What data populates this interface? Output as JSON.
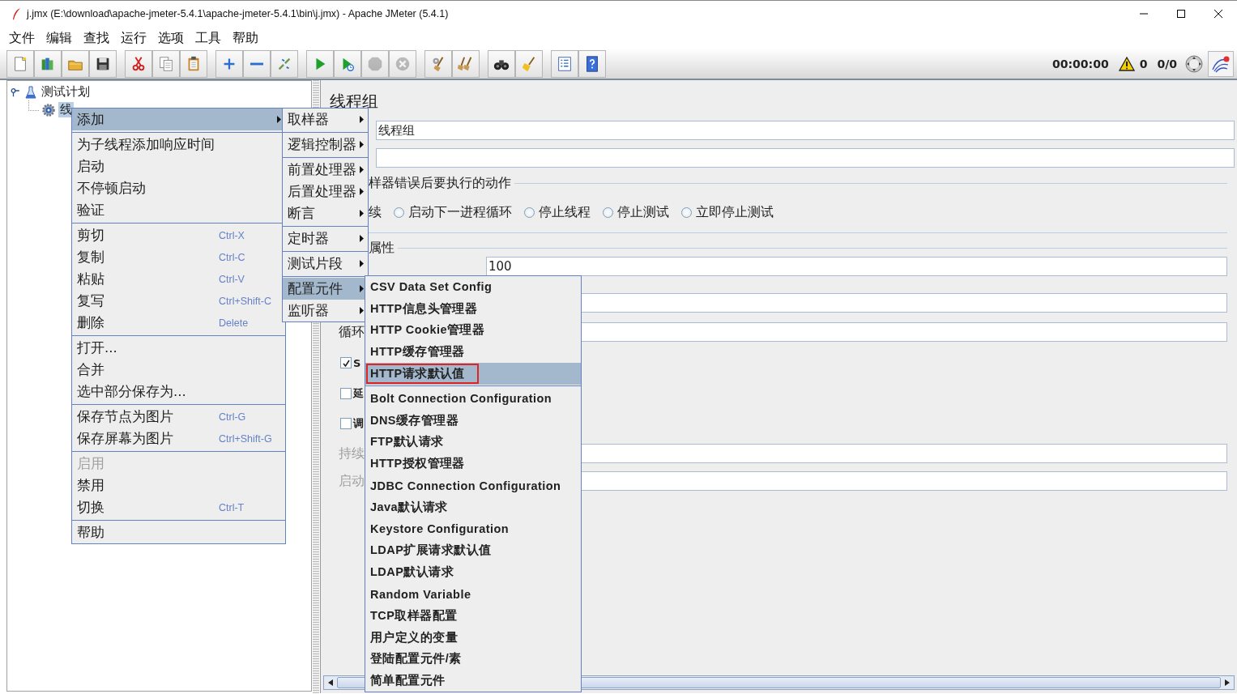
{
  "window": {
    "title": "j.jmx (E:\\download\\apache-jmeter-5.4.1\\apache-jmeter-5.4.1\\bin\\j.jmx) - Apache JMeter (5.4.1)"
  },
  "menubar": [
    "文件",
    "编辑",
    "查找",
    "运行",
    "选项",
    "工具",
    "帮助"
  ],
  "toolbar": {
    "groups": [
      [
        {
          "kind": "new",
          "disabled": false
        },
        {
          "kind": "templates",
          "disabled": false
        },
        {
          "kind": "open",
          "disabled": false
        },
        {
          "kind": "save",
          "disabled": false
        }
      ],
      [
        {
          "kind": "cut",
          "disabled": false
        },
        {
          "kind": "copy",
          "disabled": false
        },
        {
          "kind": "paste",
          "disabled": false
        }
      ],
      [
        {
          "kind": "expand",
          "disabled": false
        },
        {
          "kind": "collapse",
          "disabled": false
        },
        {
          "kind": "toggle",
          "disabled": false
        }
      ],
      [
        {
          "kind": "start",
          "disabled": false
        },
        {
          "kind": "start-no-pause",
          "disabled": false
        },
        {
          "kind": "stop",
          "disabled": true
        },
        {
          "kind": "shutdown",
          "disabled": true
        }
      ],
      [
        {
          "kind": "clear",
          "disabled": false
        },
        {
          "kind": "clear-all",
          "disabled": false
        }
      ],
      [
        {
          "kind": "search",
          "disabled": false
        },
        {
          "kind": "reset-search",
          "disabled": false
        }
      ],
      [
        {
          "kind": "function-helper",
          "disabled": false
        },
        {
          "kind": "help",
          "disabled": false
        }
      ]
    ],
    "timer": "00:00:00",
    "warnings": "0",
    "threads": "0/0"
  },
  "tree": {
    "items": [
      {
        "label": "测试计划",
        "expanded": true,
        "selected": false,
        "children": [
          {
            "label": "线",
            "selected": true
          }
        ]
      }
    ]
  },
  "panel": {
    "title": "线程组",
    "name_value": "线程组",
    "error_heading": "样器错误后要执行的动作",
    "radio_tail": "续",
    "radios": [
      {
        "label": "启动下一进程循环",
        "selected": false
      },
      {
        "label": "停止线程",
        "selected": false
      },
      {
        "label": "停止测试",
        "selected": false
      },
      {
        "label": "立即停止测试",
        "selected": false
      }
    ],
    "properties_heading": "属性",
    "thread_count": "100",
    "loop_label": "循环",
    "checkboxes": [
      {
        "label": "S",
        "checked": true
      },
      {
        "label": "延",
        "checked": false
      },
      {
        "label": "调",
        "checked": false
      }
    ],
    "fields": [
      {
        "label": "持续",
        "disabled": true
      },
      {
        "label": "启动",
        "disabled": true
      }
    ]
  },
  "context_menu": {
    "groups": [
      [
        {
          "label": "添加",
          "submenu": true,
          "selected": true,
          "disabled": false
        }
      ],
      [
        {
          "label": "为子线程添加响应时间",
          "submenu": false,
          "selected": false,
          "disabled": false
        },
        {
          "label": "启动",
          "submenu": false,
          "selected": false,
          "disabled": false
        },
        {
          "label": "不停顿启动",
          "submenu": false,
          "selected": false,
          "disabled": false
        },
        {
          "label": "验证",
          "submenu": false,
          "selected": false,
          "disabled": false
        }
      ],
      [
        {
          "label": "剪切",
          "shortcut": "Ctrl-X",
          "submenu": false,
          "selected": false,
          "disabled": false
        },
        {
          "label": "复制",
          "shortcut": "Ctrl-C",
          "submenu": false,
          "selected": false,
          "disabled": false
        },
        {
          "label": "粘贴",
          "shortcut": "Ctrl-V",
          "submenu": false,
          "selected": false,
          "disabled": false
        },
        {
          "label": "复写",
          "shortcut": "Ctrl+Shift-C",
          "submenu": false,
          "selected": false,
          "disabled": false
        },
        {
          "label": "删除",
          "shortcut": "Delete",
          "submenu": false,
          "selected": false,
          "disabled": false
        }
      ],
      [
        {
          "label": "打开...",
          "submenu": false,
          "selected": false,
          "disabled": false
        },
        {
          "label": "合并",
          "submenu": false,
          "selected": false,
          "disabled": false
        },
        {
          "label": "选中部分保存为...",
          "submenu": false,
          "selected": false,
          "disabled": false
        }
      ],
      [
        {
          "label": "保存节点为图片",
          "shortcut": "Ctrl-G",
          "submenu": false,
          "selected": false,
          "disabled": false
        },
        {
          "label": "保存屏幕为图片",
          "shortcut": "Ctrl+Shift-G",
          "submenu": false,
          "selected": false,
          "disabled": false
        }
      ],
      [
        {
          "label": "启用",
          "submenu": false,
          "selected": false,
          "disabled": true
        },
        {
          "label": "禁用",
          "submenu": false,
          "selected": false,
          "disabled": false
        },
        {
          "label": "切换",
          "shortcut": "Ctrl-T",
          "submenu": false,
          "selected": false,
          "disabled": false
        }
      ],
      [
        {
          "label": "帮助",
          "submenu": false,
          "selected": false,
          "disabled": false
        }
      ]
    ]
  },
  "add_submenu": {
    "groups": [
      [
        {
          "label": "取样器",
          "submenu": true,
          "selected": false
        }
      ],
      [
        {
          "label": "逻辑控制器",
          "submenu": true,
          "selected": false
        }
      ],
      [
        {
          "label": "前置处理器",
          "submenu": true,
          "selected": false
        },
        {
          "label": "后置处理器",
          "submenu": true,
          "selected": false
        },
        {
          "label": "断言",
          "submenu": true,
          "selected": false
        }
      ],
      [
        {
          "label": "定时器",
          "submenu": true,
          "selected": false
        }
      ],
      [
        {
          "label": "测试片段",
          "submenu": true,
          "selected": false
        }
      ],
      [
        {
          "label": "配置元件",
          "submenu": true,
          "selected": true
        },
        {
          "label": "监听器",
          "submenu": true,
          "selected": false
        }
      ]
    ]
  },
  "config_submenu": {
    "groups": [
      [
        {
          "label": "CSV Data Set Config",
          "selected": false,
          "outlined": false
        },
        {
          "label": "HTTP信息头管理器",
          "selected": false,
          "outlined": false
        },
        {
          "label": "HTTP Cookie管理器",
          "selected": false,
          "outlined": false
        },
        {
          "label": "HTTP缓存管理器",
          "selected": false,
          "outlined": false
        },
        {
          "label": "HTTP请求默认值",
          "selected": true,
          "outlined": true
        }
      ],
      [
        {
          "label": "Bolt Connection Configuration",
          "selected": false,
          "outlined": false
        },
        {
          "label": "DNS缓存管理器",
          "selected": false,
          "outlined": false
        },
        {
          "label": "FTP默认请求",
          "selected": false,
          "outlined": false
        },
        {
          "label": "HTTP授权管理器",
          "selected": false,
          "outlined": false
        },
        {
          "label": "JDBC Connection Configuration",
          "selected": false,
          "outlined": false
        },
        {
          "label": "Java默认请求",
          "selected": false,
          "outlined": false
        },
        {
          "label": "Keystore Configuration",
          "selected": false,
          "outlined": false
        },
        {
          "label": "LDAP扩展请求默认值",
          "selected": false,
          "outlined": false
        },
        {
          "label": "LDAP默认请求",
          "selected": false,
          "outlined": false
        },
        {
          "label": "Random Variable",
          "selected": false,
          "outlined": false
        },
        {
          "label": "TCP取样器配置",
          "selected": false,
          "outlined": false
        },
        {
          "label": "用户定义的变量",
          "selected": false,
          "outlined": false
        },
        {
          "label": "登陆配置元件/素",
          "selected": false,
          "outlined": false
        },
        {
          "label": "简单配置元件",
          "selected": false,
          "outlined": false
        }
      ]
    ]
  }
}
